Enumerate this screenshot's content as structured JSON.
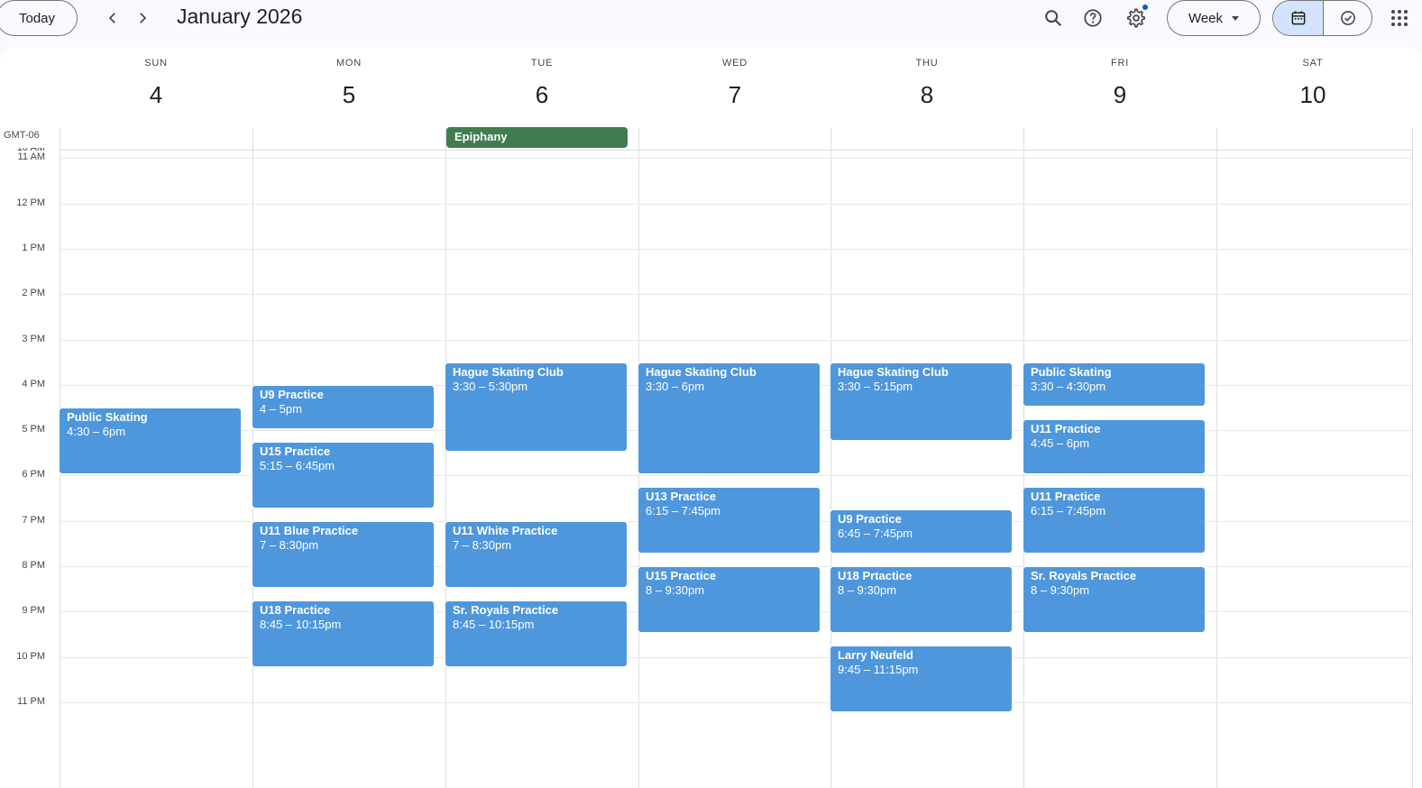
{
  "header": {
    "today_label": "Today",
    "month_title": "January 2026",
    "view_label": "Week",
    "icons": [
      "chevron-left-icon",
      "chevron-right-icon",
      "search-icon",
      "help-icon",
      "gear-icon",
      "calendar-icon",
      "tasks-check-icon",
      "apps-grid-icon"
    ]
  },
  "timezone": "GMT-06",
  "days": [
    {
      "name": "SUN",
      "num": "4"
    },
    {
      "name": "MON",
      "num": "5"
    },
    {
      "name": "TUE",
      "num": "6"
    },
    {
      "name": "WED",
      "num": "7"
    },
    {
      "name": "THU",
      "num": "8"
    },
    {
      "name": "FRI",
      "num": "9"
    },
    {
      "name": "SAT",
      "num": "10"
    }
  ],
  "hours": [
    "10 AM",
    "11 AM",
    "12 PM",
    "1 PM",
    "2 PM",
    "3 PM",
    "4 PM",
    "5 PM",
    "6 PM",
    "7 PM",
    "8 PM",
    "9 PM",
    "10 PM",
    "11 PM"
  ],
  "all_day": {
    "title": "Epiphany",
    "day": 2,
    "color": "#3f7d4f"
  },
  "event_color": "#4f97dc",
  "events": [
    {
      "day": 0,
      "title": "Public Skating",
      "time": "4:30 – 6pm",
      "start": 16.5,
      "end": 18
    },
    {
      "day": 1,
      "title": "U9 Practice",
      "time": "4 – 5pm",
      "start": 16,
      "end": 17
    },
    {
      "day": 1,
      "title": "U15 Practice",
      "time": "5:15 – 6:45pm",
      "start": 17.25,
      "end": 18.75
    },
    {
      "day": 1,
      "title": "U11 Blue Practice",
      "time": "7 – 8:30pm",
      "start": 19,
      "end": 20.5
    },
    {
      "day": 1,
      "title": "U18 Practice",
      "time": "8:45 – 10:15pm",
      "start": 20.75,
      "end": 22.25
    },
    {
      "day": 2,
      "title": "Hague Skating Club",
      "time": "3:30 – 5:30pm",
      "start": 15.5,
      "end": 17.5
    },
    {
      "day": 2,
      "title": "U11 White Practice",
      "time": "7 – 8:30pm",
      "start": 19,
      "end": 20.5
    },
    {
      "day": 2,
      "title": "Sr. Royals Practice",
      "time": "8:45 – 10:15pm",
      "start": 20.75,
      "end": 22.25
    },
    {
      "day": 3,
      "title": "Hague Skating Club",
      "time": "3:30 – 6pm",
      "start": 15.5,
      "end": 18
    },
    {
      "day": 3,
      "title": "U13 Practice",
      "time": "6:15 – 7:45pm",
      "start": 18.25,
      "end": 19.75
    },
    {
      "day": 3,
      "title": "U15 Practice",
      "time": "8 – 9:30pm",
      "start": 20,
      "end": 21.5
    },
    {
      "day": 4,
      "title": "Hague Skating Club",
      "time": "3:30 – 5:15pm",
      "start": 15.5,
      "end": 17.25
    },
    {
      "day": 4,
      "title": "U9 Practice",
      "time": "6:45 – 7:45pm",
      "start": 18.75,
      "end": 19.75
    },
    {
      "day": 4,
      "title": "U18 Prtactice",
      "time": "8 – 9:30pm",
      "start": 20,
      "end": 21.5
    },
    {
      "day": 4,
      "title": "Larry Neufeld",
      "time": "9:45 – 11:15pm",
      "start": 21.75,
      "end": 23.25
    },
    {
      "day": 5,
      "title": "Public Skating",
      "time": "3:30 – 4:30pm",
      "start": 15.5,
      "end": 16.5
    },
    {
      "day": 5,
      "title": "U11 Practice",
      "time": "4:45 – 6pm",
      "start": 16.75,
      "end": 18
    },
    {
      "day": 5,
      "title": "U11 Practice",
      "time": "6:15 – 7:45pm",
      "start": 18.25,
      "end": 19.75
    },
    {
      "day": 5,
      "title": "Sr. Royals Practice",
      "time": "8 – 9:30pm",
      "start": 20,
      "end": 21.5
    }
  ]
}
